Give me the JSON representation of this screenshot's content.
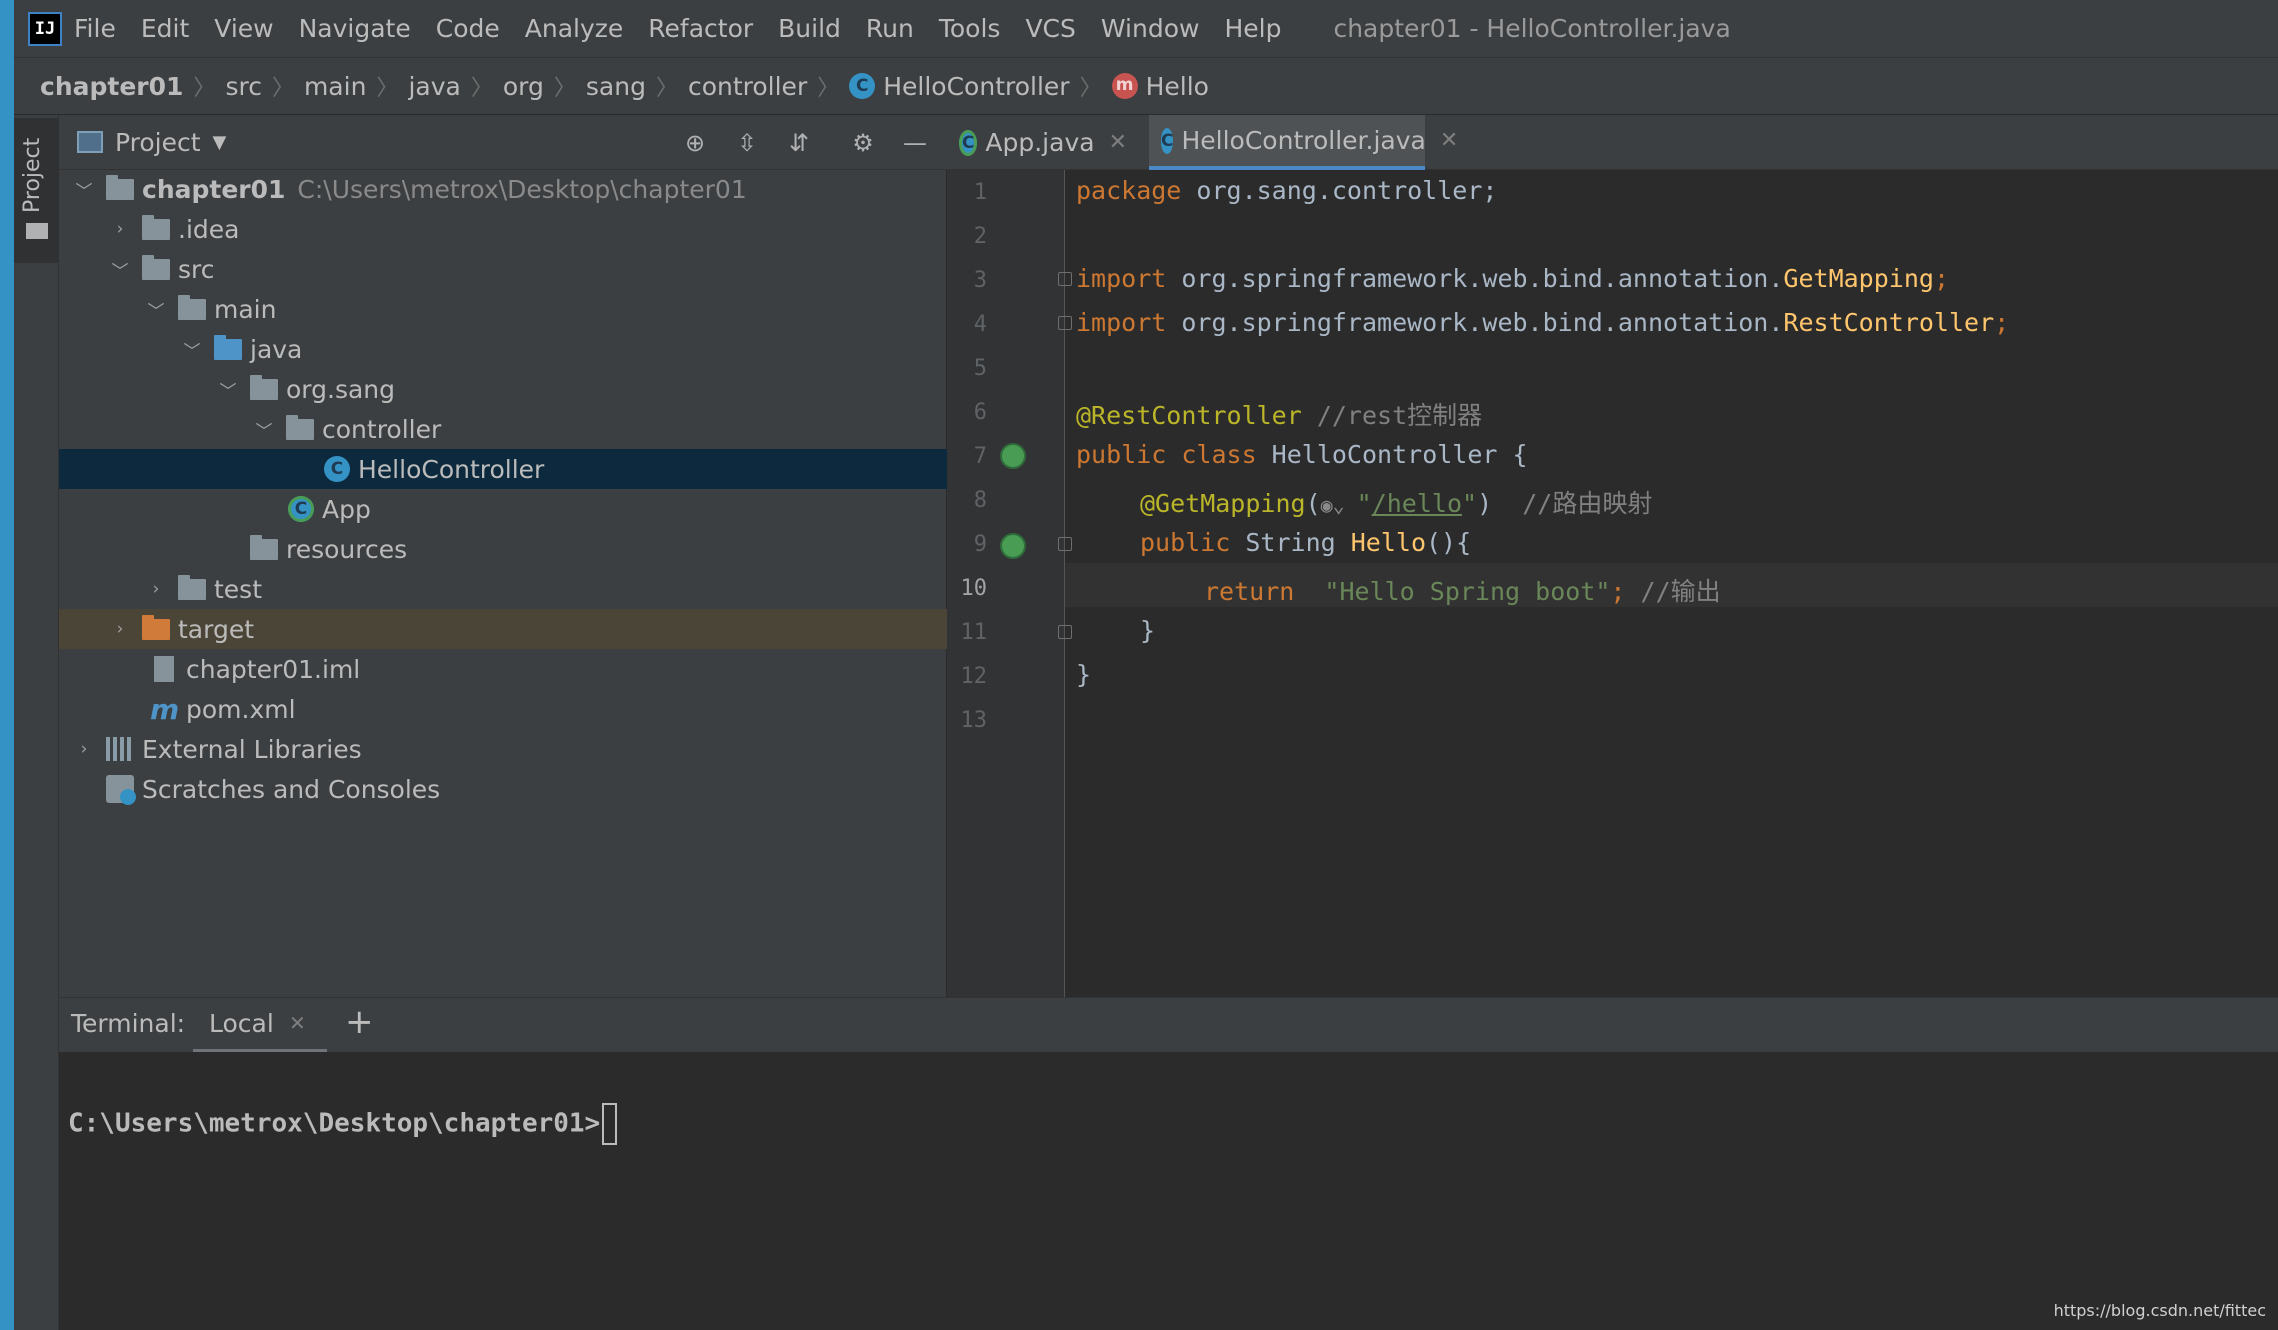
{
  "menubar": {
    "logo": "IJ",
    "items": [
      "File",
      "Edit",
      "View",
      "Navigate",
      "Code",
      "Analyze",
      "Refactor",
      "Build",
      "Run",
      "Tools",
      "VCS",
      "Window",
      "Help"
    ],
    "window_title": "chapter01 - HelloController.java"
  },
  "breadcrumb": {
    "items": [
      "chapter01",
      "src",
      "main",
      "java",
      "org",
      "sang",
      "controller"
    ],
    "class_item": "HelloController",
    "method_item": "Hello",
    "class_icon": "C",
    "method_icon": "m"
  },
  "sidebar": {
    "project_tab": "Project"
  },
  "project_panel": {
    "title": "Project",
    "tree": {
      "root": "chapter01",
      "root_path": "C:\\Users\\metrox\\Desktop\\chapter01",
      "idea": ".idea",
      "src": "src",
      "main": "main",
      "java": "java",
      "org_sang": "org.sang",
      "controller": "controller",
      "hello_controller": "HelloController",
      "app": "App",
      "resources": "resources",
      "test": "test",
      "target": "target",
      "iml": "chapter01.iml",
      "pom": "pom.xml",
      "ext_libs": "External Libraries",
      "scratches": "Scratches and Consoles"
    }
  },
  "editor": {
    "tabs": [
      {
        "label": "App.java"
      },
      {
        "label": "HelloController.java"
      }
    ],
    "line_numbers": [
      "1",
      "2",
      "3",
      "4",
      "5",
      "6",
      "7",
      "8",
      "9",
      "10",
      "11",
      "12",
      "13"
    ],
    "code": {
      "l1_kw": "package",
      "l1_rest": " org.sang.controller;",
      "l3_kw": "import",
      "l3_path": " org.springframework.web.bind.annotation.",
      "l3_cls": "GetMapping",
      "l4_kw": "import",
      "l4_path": " org.springframework.web.bind.annotation.",
      "l4_cls": "RestController",
      "semi": ";",
      "l6_ann": "@RestController",
      "l6_cmt": " //rest控制器",
      "l7_kw": "public class",
      "l7_rest": " HelloController {",
      "l8_ann": "@GetMapping",
      "l8_open": "(",
      "l8_q1": "\"",
      "l8_path": "/hello",
      "l8_q2": "\"",
      "l8_close": ")",
      "l8_cmt": "  //路由映射",
      "l9_kw": "public",
      "l9_type": " String ",
      "l9_fn": "Hello",
      "l9_rest": "(){",
      "l10_kw": "return",
      "l10_str": "\"Hello Spring boot\"",
      "l10_semi": ";",
      "l10_cmt": " //输出",
      "l11": "}",
      "l12": "}"
    }
  },
  "terminal": {
    "label": "Terminal:",
    "tab": "Local",
    "add": "+",
    "prompt": "C:\\Users\\metrox\\Desktop\\chapter01>"
  },
  "watermark": "https://blog.csdn.net/fittec",
  "colors": {
    "accent": "#4a88c7",
    "selection": "#0d293e",
    "keyword": "#cc7832",
    "annotation": "#bbb529",
    "string": "#6a8759"
  }
}
